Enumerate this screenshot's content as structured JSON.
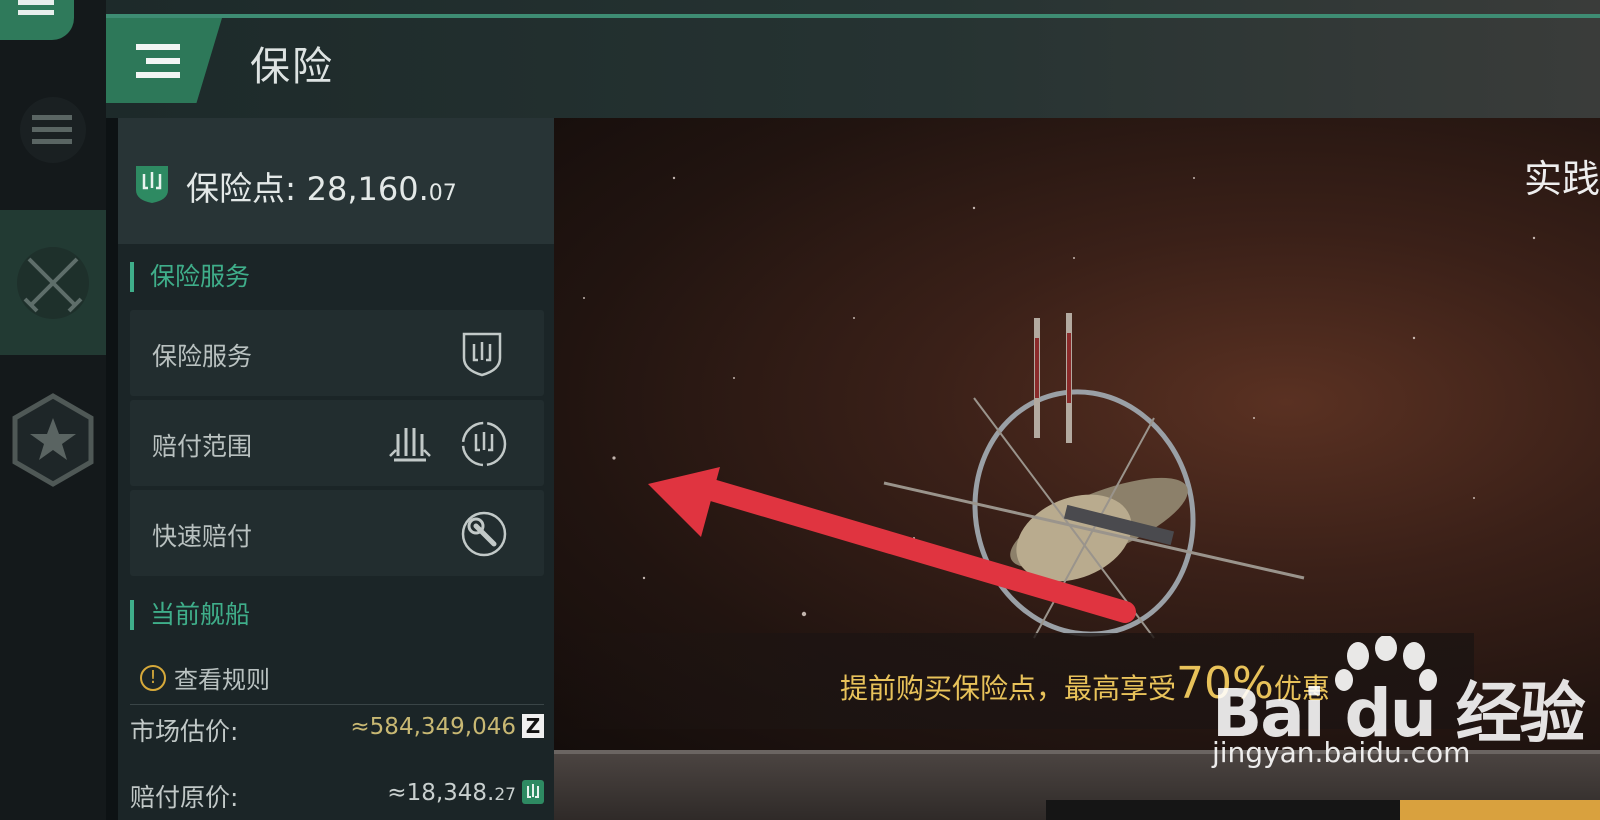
{
  "header": {
    "title": "保险"
  },
  "points": {
    "label": "保险点:",
    "value_main": "28,160.",
    "value_dec": "07"
  },
  "sections": {
    "service_title": "保险服务",
    "service_rows": [
      {
        "label": "保险服务"
      },
      {
        "label": "赔付范围"
      },
      {
        "label": "快速赔付"
      }
    ],
    "ship_title": "当前舰船",
    "rules_link": "查看规则"
  },
  "ship": {
    "market_label": "市场估价:",
    "market_value": "≈584,349,046",
    "market_badge": "Z",
    "payout_label": "赔付原价:",
    "payout_value": "≈18,348.",
    "payout_dec": "27"
  },
  "scene": {
    "tag": "实践",
    "promo_text": "提前购买保险点，最高享受",
    "promo_pct": "70%",
    "promo_suffix": "优惠"
  },
  "watermark": {
    "logo": "Bai du 经验",
    "url": "jingyan.baidu.com"
  },
  "colors": {
    "accent": "#3fae8a",
    "tab": "#2d7859",
    "gold": "#e8c25a",
    "arrow": "#e03440"
  },
  "icons": [
    "menu-icon",
    "combat-swords-icon",
    "star-badge-icon",
    "insurance-shield-icon",
    "coverage-ships-icon",
    "coverage-circle-icon",
    "quick-payout-wrench-icon",
    "warning-icon",
    "isk-icon"
  ]
}
